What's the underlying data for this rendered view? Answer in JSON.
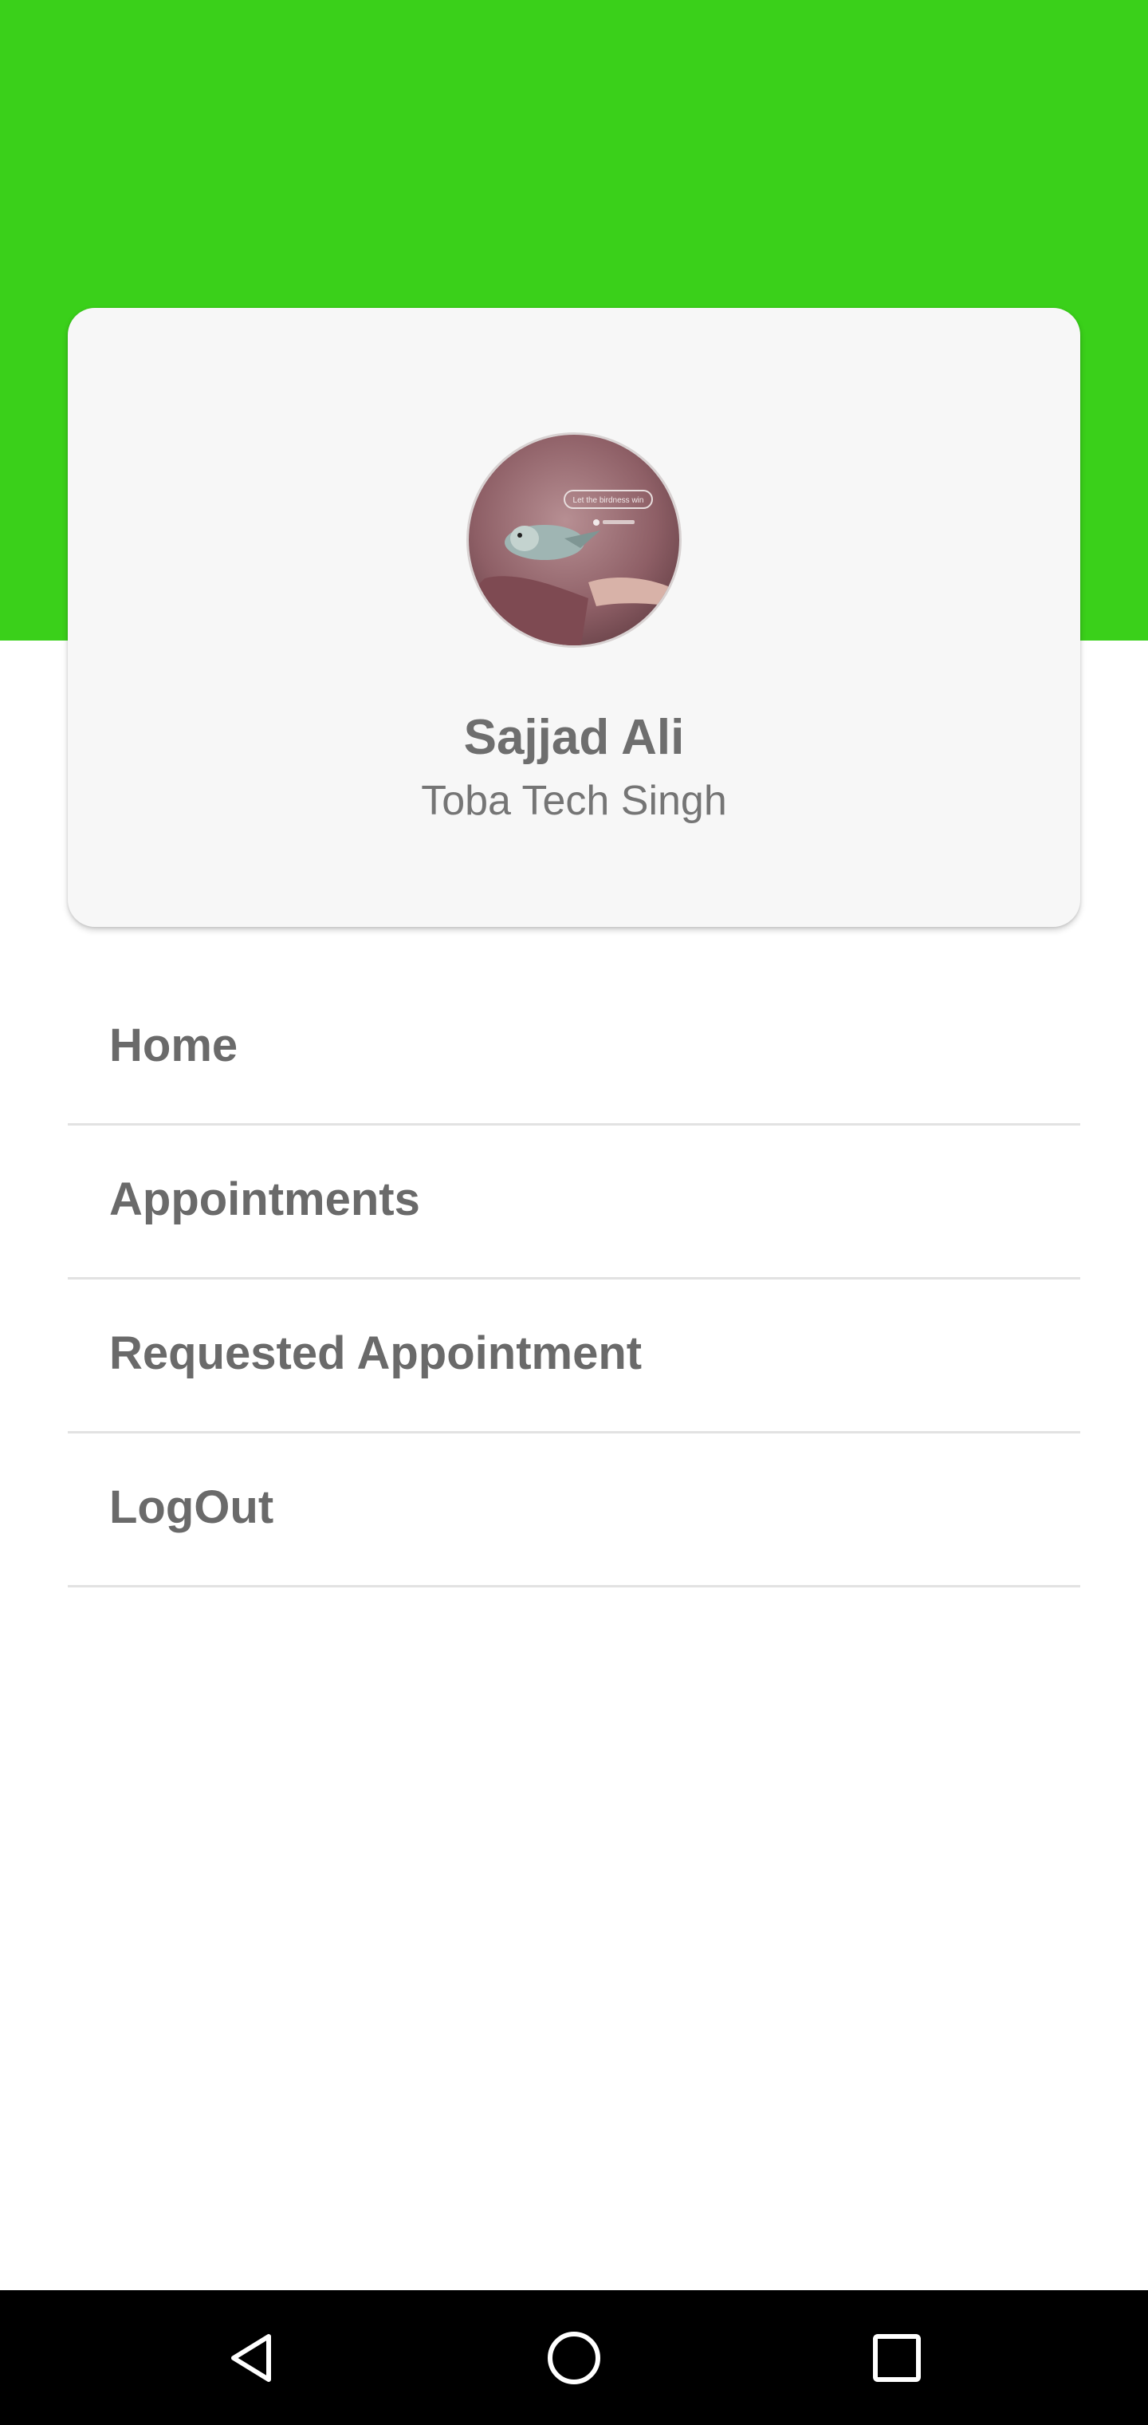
{
  "colors": {
    "header": "#3ad01a",
    "card": "#f7f7f7",
    "text_primary": "#6e6e6e",
    "divider": "#e2e2e2",
    "nav_bar": "#000000"
  },
  "profile": {
    "name": "Sajjad Ali",
    "city": "Toba Tech Singh",
    "avatar_caption": "Let the birdness win"
  },
  "menu": {
    "items": [
      {
        "label": "Home"
      },
      {
        "label": "Appointments"
      },
      {
        "label": "Requested Appointment"
      },
      {
        "label": "LogOut"
      }
    ]
  },
  "system_nav": {
    "icons": [
      "back-icon",
      "home-circle-icon",
      "recents-square-icon"
    ]
  }
}
